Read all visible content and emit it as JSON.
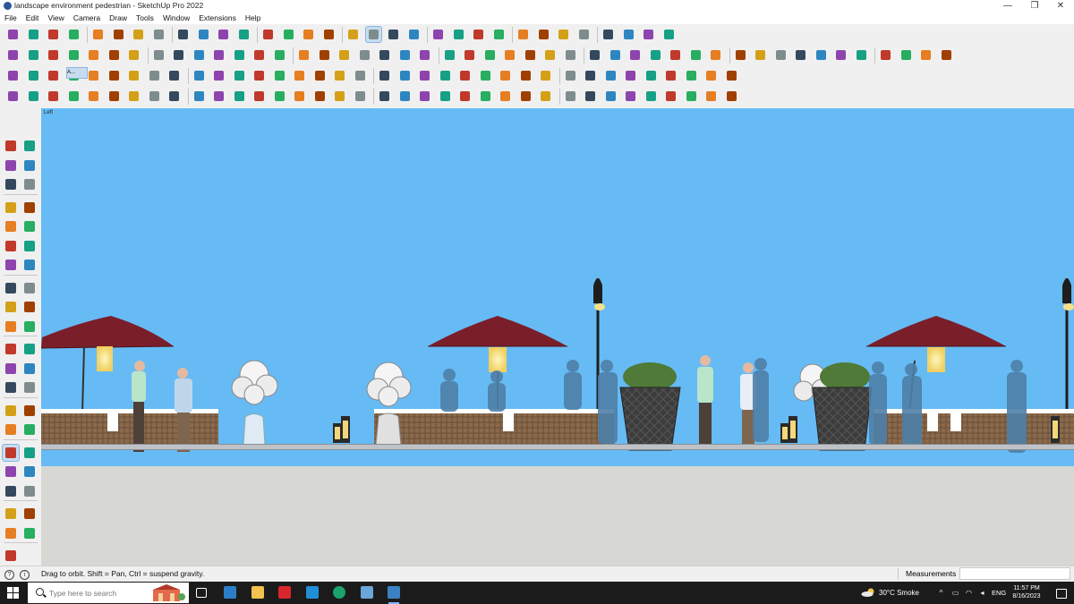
{
  "window": {
    "title": "landscape environment pedestrian - SketchUp Pro 2022",
    "minimize": "—",
    "restore": "❐",
    "close": "✕"
  },
  "menu": [
    "File",
    "Edit",
    "View",
    "Camera",
    "Draw",
    "Tools",
    "Window",
    "Extensions",
    "Help"
  ],
  "viewport": {
    "scene_label": "Left",
    "sky_color": "#66bbf5",
    "ground_color": "#d7d7d3"
  },
  "toolbar": {
    "small_tab_label": "A..."
  },
  "status": {
    "hint": "Drag to orbit. Shift = Pan, Ctrl = suspend gravity.",
    "measurements_label": "Measurements",
    "measurements_value": ""
  },
  "taskbar": {
    "search_placeholder": "Type here to search",
    "weather": "30°C  Smoke",
    "language": "ENG",
    "time": "11:57 PM",
    "date": "8/16/2023"
  },
  "icons": {
    "toolbar_row1": [
      "search-icon",
      "select-arrow-icon",
      "eraser-icon",
      "pencil-icon",
      "lasso-icon",
      "paint-bucket-icon",
      "push-pull-icon",
      "follow-me-icon",
      "move-icon",
      "rotate-icon",
      "scale-icon",
      "tape-measure-icon",
      "dimension-icon",
      "protractor-icon",
      "orbit-icon",
      "pan-icon",
      "zoom-icon",
      "zoom-extents-icon",
      "section-plane-icon",
      "layers-icon",
      "styles-icon",
      "component-icon",
      "warehouse-icon",
      "extension-icon",
      "axes-icon",
      "sandbox-icon",
      "solid-tools-icon",
      "intersect-icon",
      "subtract-icon",
      "undo-icon",
      "redo-icon",
      "hand-icon"
    ],
    "left_tools": [
      "select-arrow-icon",
      "orbit-icon",
      "paint-bucket-icon",
      "eraser-icon",
      "component-icon",
      "pencil-icon",
      "line-icon",
      "freehand-icon",
      "rectangle-icon",
      "rotated-rectangle-icon",
      "circle-icon",
      "polygon-icon",
      "arc-icon",
      "two-point-arc-icon",
      "pie-icon",
      "three-point-arc-icon",
      "move-icon",
      "push-pull-icon",
      "rotate-icon",
      "follow-me-icon",
      "scale-icon",
      "offset-icon",
      "tape-measure-icon",
      "dimension-icon",
      "protractor-icon",
      "text-icon",
      "axes-icon",
      "3d-text-icon",
      "orbit-icon",
      "pan-icon",
      "zoom-icon",
      "zoom-window-icon",
      "zoom-extents-icon",
      "previous-icon",
      "position-camera-icon",
      "look-around-icon",
      "walk-icon",
      "section-plane-icon",
      "display-section-icon",
      "layers-icon",
      "styles-icon"
    ]
  }
}
